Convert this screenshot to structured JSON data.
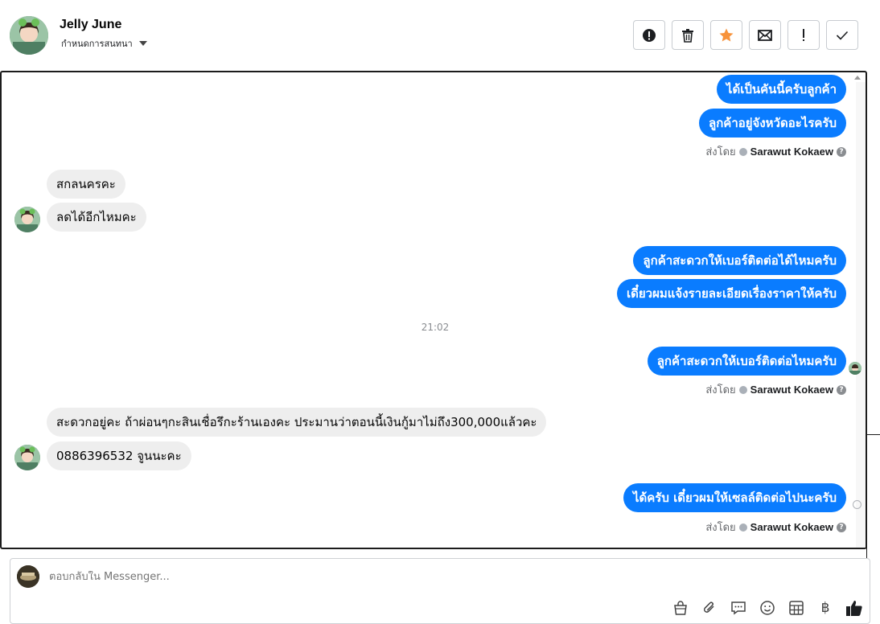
{
  "header": {
    "name": "Jelly June",
    "subtitle": "กำหนดการสนทนา",
    "actions": [
      "alert-circle-icon",
      "trash-icon",
      "star-icon",
      "envelope-icon",
      "exclamation-icon",
      "check-icon"
    ],
    "star_color": "#f7923a"
  },
  "conversation": {
    "messages_top": [
      {
        "dir": "out",
        "text": "ได้เป็นคันนี้ครับลูกค้า"
      },
      {
        "dir": "out",
        "text": "ลูกค้าอยู่จังหวัดอะไรครับ"
      }
    ],
    "sent_by_label": "ส่งโดย",
    "sent_by_name": "Sarawut Kokaew",
    "in_group_1": [
      "สกลนครคะ",
      "ลดได้อีกไหมคะ"
    ],
    "out_group_2": [
      "ลูกค้าสะดวกให้เบอร์ติดต่อได้ไหมครับ",
      "เดี๋ยวผมแจ้งรายละเอียดเรื่องราคาให้ครับ"
    ],
    "timestamp": "21:02",
    "out_group_3": [
      "ลูกค้าสะดวกให้เบอร์ติดต่อไหมครับ"
    ],
    "in_group_2": [
      "สะดวกอยู่คะ ถ้าผ่อนๆกะสินเชื่อรึกะร้านเองคะ ประมานว่าตอนนี้เงินกู้มาไม่ถึง300,000แล้วคะ",
      "0886396532 จูนนะคะ"
    ],
    "out_group_4": [
      "ได้ครับ เดี๋ยวผมให้เซลล์ติดต่อไปนะครับ"
    ],
    "bubble_out_color": "#0a7cff",
    "bubble_in_color": "#eeeeee"
  },
  "composer": {
    "placeholder": "ตอบกลับใน Messenger...",
    "tools": [
      "bag-icon",
      "paperclip-icon",
      "chat-bubbles-icon",
      "smiley-icon",
      "calculator-icon",
      "baht-icon",
      "thumbs-up-icon"
    ],
    "baht_symbol": "฿"
  }
}
